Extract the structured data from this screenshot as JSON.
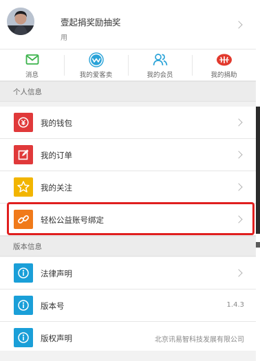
{
  "profile": {
    "name": "壹起捐奖励抽奖",
    "subtitle": "用"
  },
  "quicknav": [
    {
      "label": "消息",
      "icon": "message-icon",
      "color": "#3ab24a"
    },
    {
      "label": "我的爱客卖",
      "icon": "aikemai-icon",
      "color": "#2aa3d8"
    },
    {
      "label": "我的会员",
      "icon": "members-icon",
      "color": "#2aa3d8"
    },
    {
      "label": "我的捐助",
      "icon": "donation-icon",
      "color": "#e23a2e"
    }
  ],
  "sections": {
    "personal": "个人信息",
    "version": "版本信息"
  },
  "personal_items": [
    {
      "label": "我的钱包",
      "icon": "wallet-icon",
      "color": "#e0393a"
    },
    {
      "label": "我的订单",
      "icon": "order-icon",
      "color": "#e0393a"
    },
    {
      "label": "我的关注",
      "icon": "star-icon",
      "color": "#f2b500"
    },
    {
      "label": "轻松公益账号绑定",
      "icon": "link-icon",
      "color": "#f07a1a"
    }
  ],
  "version_items": [
    {
      "label": "法律声明",
      "icon": "info-icon",
      "color": "#1a9fd8",
      "value": ""
    },
    {
      "label": "版本号",
      "icon": "info-icon",
      "color": "#1a9fd8",
      "value": "1.4.3"
    },
    {
      "label": "版权声明",
      "icon": "info-icon",
      "color": "#1a9fd8",
      "value": "北京讯易智科技发展有限公司"
    }
  ],
  "colors": {
    "highlight": "#e01e1e",
    "background": "#f2f2f2"
  }
}
